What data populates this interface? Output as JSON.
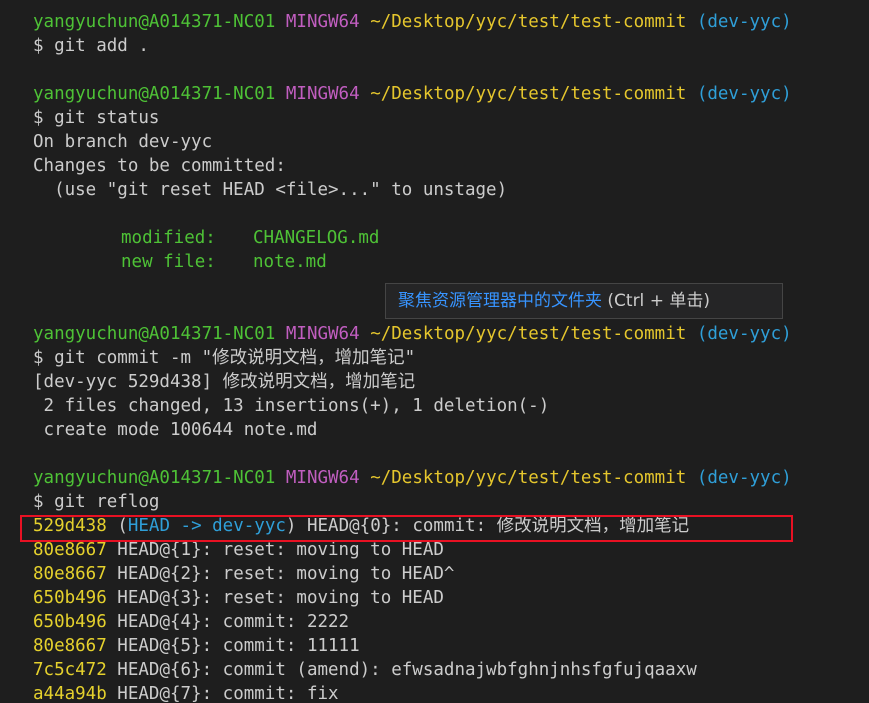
{
  "prompts": [
    {
      "user": "yangyuchun@A014371-NC01",
      "shell": "MINGW64",
      "path": "~/Desktop/yyc/test/test-commit",
      "branch": "(dev-yyc)"
    },
    {
      "user": "yangyuchun@A014371-NC01",
      "shell": "MINGW64",
      "path": "~/Desktop/yyc/test/test-commit",
      "branch": "(dev-yyc)"
    },
    {
      "user": "yangyuchun@A014371-NC01",
      "shell": "MINGW64",
      "path": "~/Desktop/yyc/test/test-commit",
      "branch": "(dev-yyc)"
    },
    {
      "user": "yangyuchun@A014371-NC01",
      "shell": "MINGW64",
      "path": "~/Desktop/yyc/test/test-commit",
      "branch": "(dev-yyc)"
    }
  ],
  "commands": {
    "add": "$ git add .",
    "status": "$ git status",
    "commit": "$ git commit -m \"修改说明文档，增加笔记\"",
    "reflog": "$ git reflog"
  },
  "status_output": {
    "branch": "On branch dev-yyc",
    "changes": "Changes to be committed:",
    "hint": "  (use \"git reset HEAD <file>...\" to unstage)",
    "files": [
      {
        "kind": "modified:",
        "name": "CHANGELOG.md"
      },
      {
        "kind": "new file:",
        "name": "note.md"
      }
    ]
  },
  "commit_output": {
    "summary": "[dev-yyc 529d438] 修改说明文档，增加笔记",
    "stats": " 2 files changed, 13 insertions(+), 1 deletion(-)",
    "mode": " create mode 100644 note.md"
  },
  "reflog": {
    "head_entry": {
      "hash": "529d438",
      "open_paren": "(",
      "head_ref": "HEAD -> dev-yyc",
      "close_paren": ")",
      "rest": " HEAD@{0}: commit: 修改说明文档，增加笔记"
    },
    "entries": [
      {
        "hash": "80e8667",
        "rest": " HEAD@{1}: reset: moving to HEAD"
      },
      {
        "hash": "80e8667",
        "rest": " HEAD@{2}: reset: moving to HEAD^"
      },
      {
        "hash": "650b496",
        "rest": " HEAD@{3}: reset: moving to HEAD"
      },
      {
        "hash": "650b496",
        "rest": " HEAD@{4}: commit: 2222"
      },
      {
        "hash": "80e8667",
        "rest": " HEAD@{5}: commit: 11111"
      },
      {
        "hash": "7c5c472",
        "rest": " HEAD@{6}: commit (amend): efwsadnajwbfghnjnhsfgfujqaaxw"
      },
      {
        "hash": "a44a94b",
        "rest": " HEAD@{7}: commit: fix"
      }
    ]
  },
  "tooltip": {
    "link_text": "聚焦资源管理器中的文件夹",
    "shortcut": " (Ctrl + 单击)"
  },
  "colors": {
    "background": "#1e1e1e",
    "user": "#4ec236",
    "shell": "#c15ec0",
    "path": "#e5c62d",
    "branch": "#2f9fd8",
    "highlight": "#e81123"
  }
}
